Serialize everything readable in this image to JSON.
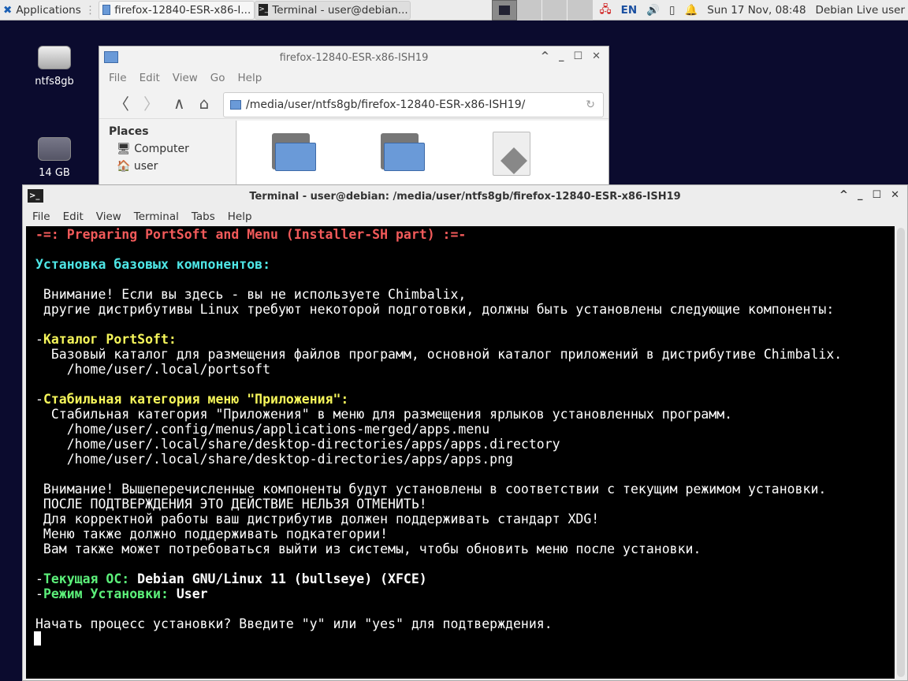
{
  "panel": {
    "apps": "Applications",
    "tasks": [
      "firefox-12840-ESR-x86-I...",
      "Terminal - user@debian..."
    ],
    "lang": "EN",
    "clock": "Sun 17 Nov, 08:48",
    "user": "Debian Live user"
  },
  "desktop": [
    {
      "label": "ntfs8gb"
    },
    {
      "label": "14 GB"
    }
  ],
  "fm": {
    "title": "firefox-12840-ESR-x86-ISH19",
    "menu": [
      "File",
      "Edit",
      "View",
      "Go",
      "Help"
    ],
    "path": "/media/user/ntfs8gb/firefox-12840-ESR-x86-ISH19/",
    "places_title": "Places",
    "places": [
      "Computer",
      "user"
    ]
  },
  "term": {
    "title": "Terminal - user@debian: /media/user/ntfs8gb/firefox-12840-ESR-x86-ISH19",
    "menu": [
      "File",
      "Edit",
      "View",
      "Terminal",
      "Tabs",
      "Help"
    ],
    "colors": {
      "red": "#f25a5a",
      "cyan": "#4ee6e6",
      "yellow": "#f5f55a",
      "green": "#5cf07a",
      "white": "#ffffff"
    },
    "lines": [
      [
        {
          "t": "-=: Preparing PortSoft and Menu (Installer-SH part) :=-",
          "c": "red",
          "b": 1
        }
      ],
      [],
      [
        {
          "t": "Установка базовых компонентов:",
          "c": "cyan",
          "b": 1
        }
      ],
      [],
      [
        {
          "t": " Внимание! Если вы здесь - вы не используете Chimbalix,"
        }
      ],
      [
        {
          "t": " другие дистрибутивы Linux требуют некоторой подготовки, должны быть установлены следующие компоненты:"
        }
      ],
      [],
      [
        {
          "t": "-"
        },
        {
          "t": "Каталог PortSoft:",
          "c": "yellow",
          "b": 1
        }
      ],
      [
        {
          "t": "  Базовый каталог для размещения файлов программ, основной каталог приложений в дистрибутиве Chimbalix."
        }
      ],
      [
        {
          "t": "    /home/user/.local/portsoft"
        }
      ],
      [],
      [
        {
          "t": "-"
        },
        {
          "t": "Стабильная категория меню \"Приложения\":",
          "c": "yellow",
          "b": 1
        }
      ],
      [
        {
          "t": "  Стабильная категория \"Приложения\" в меню для размещения ярлыков установленных программ."
        }
      ],
      [
        {
          "t": "    /home/user/.config/menus/applications-merged/apps.menu"
        }
      ],
      [
        {
          "t": "    /home/user/.local/share/desktop-directories/apps/apps.directory"
        }
      ],
      [
        {
          "t": "    /home/user/.local/share/desktop-directories/apps/apps.png"
        }
      ],
      [],
      [
        {
          "t": " Внимание! Вышеперечисленные компоненты будут установлены в соответствии с текущим режимом установки."
        }
      ],
      [
        {
          "t": " ПОСЛЕ ПОДТВЕРЖДЕНИЯ ЭТО ДЕЙСТВИЕ НЕЛЬЗЯ ОТМЕНИТЬ!"
        }
      ],
      [
        {
          "t": " Для корректной работы ваш дистрибутив должен поддерживать стандарт XDG!"
        }
      ],
      [
        {
          "t": " Меню также должно поддерживать подкатегории!"
        }
      ],
      [
        {
          "t": " Вам также может потребоваться выйти из системы, чтобы обновить меню после установки."
        }
      ],
      [],
      [
        {
          "t": "-"
        },
        {
          "t": "Текущая ОС: ",
          "c": "green",
          "b": 1
        },
        {
          "t": "Debian GNU/Linux 11 (bullseye) (XFCE)",
          "b": 1
        }
      ],
      [
        {
          "t": "-"
        },
        {
          "t": "Режим Установки: ",
          "c": "green",
          "b": 1
        },
        {
          "t": "User",
          "b": 1
        }
      ],
      [],
      [
        {
          "t": "Начать процесс установки? Введите \"y\" или \"yes\" для подтверждения."
        }
      ]
    ]
  }
}
